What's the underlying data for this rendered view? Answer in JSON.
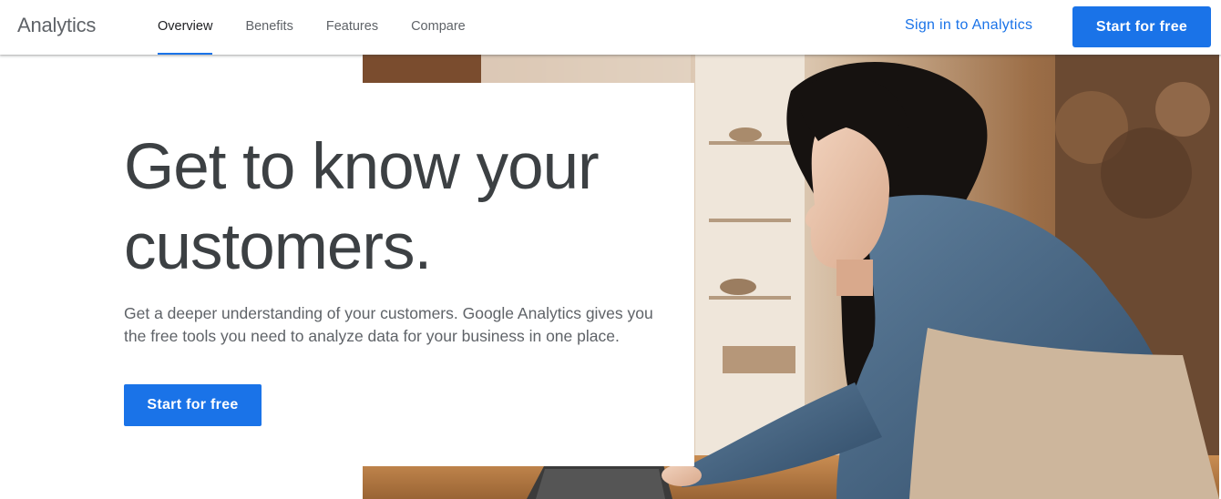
{
  "header": {
    "brand": "Analytics",
    "nav": [
      {
        "label": "Overview",
        "active": true
      },
      {
        "label": "Benefits",
        "active": false
      },
      {
        "label": "Features",
        "active": false
      },
      {
        "label": "Compare",
        "active": false
      }
    ],
    "sign_in_label": "Sign in to Analytics",
    "cta_label": "Start for free"
  },
  "hero": {
    "headline": "Get to know your customers.",
    "subtext": "Get a deeper understanding of your customers. Google Analytics gives you the free tools you need to analyze data for your business in one place.",
    "cta_label": "Start for free"
  },
  "colors": {
    "accent": "#1a73e8",
    "heading": "#3c4043",
    "body_text": "#5f6368"
  }
}
